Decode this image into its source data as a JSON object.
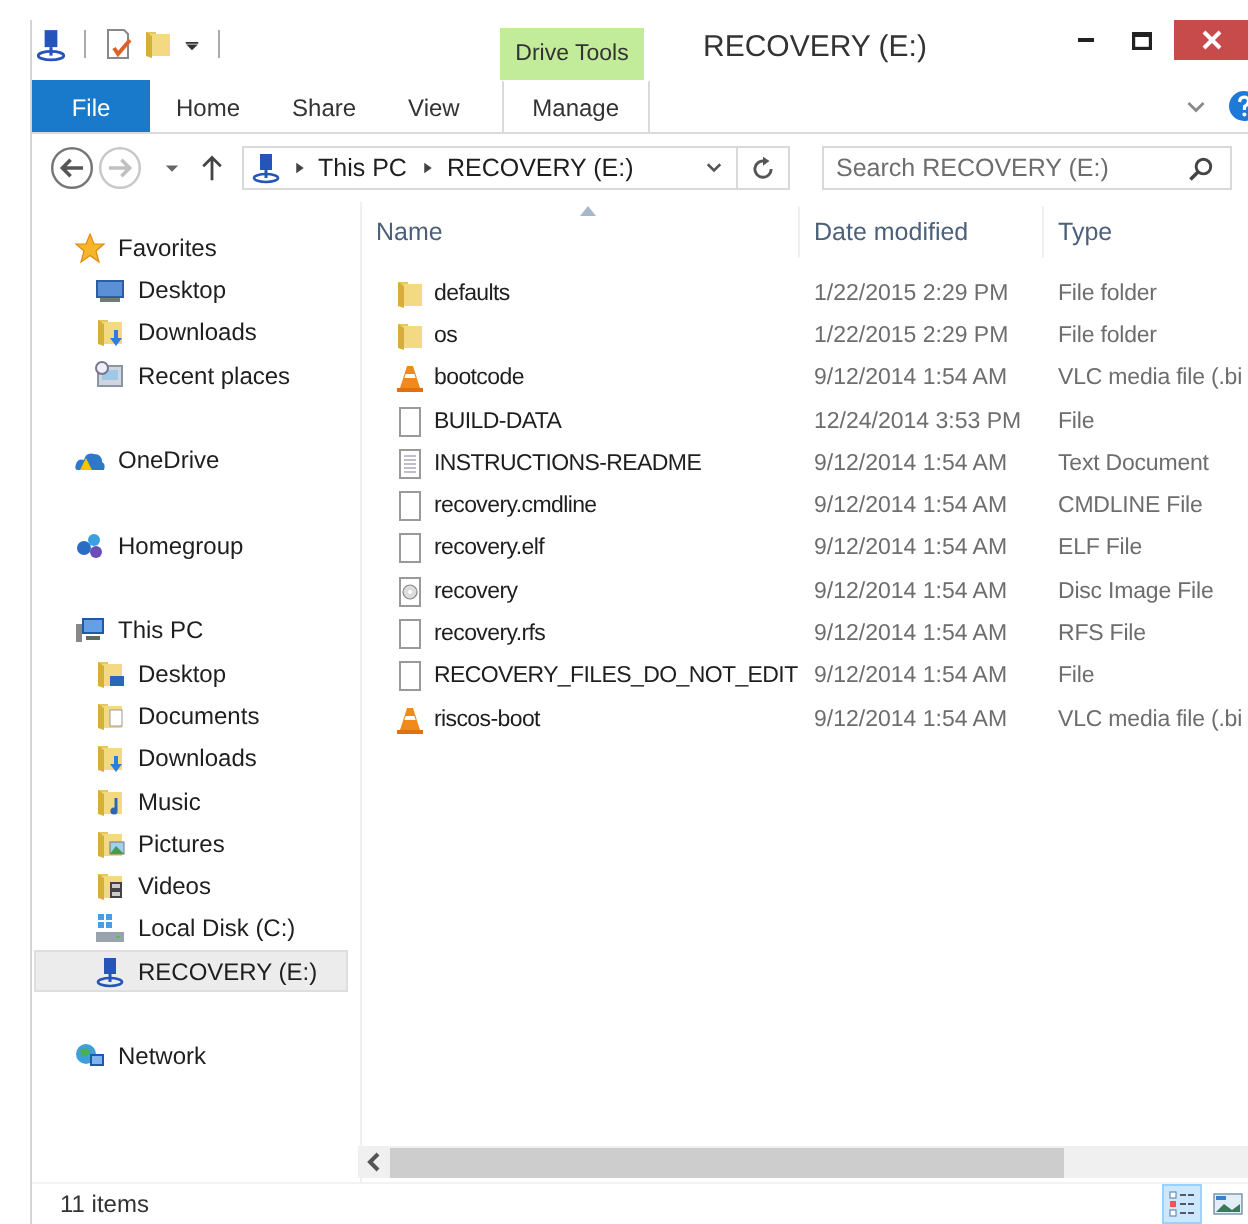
{
  "window": {
    "title": "RECOVERY (E:)",
    "context_tab": "Drive Tools"
  },
  "ribbon_tabs": [
    {
      "label": "File",
      "kind": "file",
      "selected": false
    },
    {
      "label": "Home",
      "kind": "tab",
      "selected": false
    },
    {
      "label": "Share",
      "kind": "tab",
      "selected": false
    },
    {
      "label": "View",
      "kind": "tab",
      "selected": false
    },
    {
      "label": "Manage",
      "kind": "context",
      "selected": false
    }
  ],
  "address": {
    "crumbs": [
      "This PC",
      "RECOVERY (E:)"
    ],
    "search": {
      "placeholder": "Search RECOVERY (E:)"
    }
  },
  "sidebar": {
    "groups": [
      {
        "label": "Favorites",
        "kind": "star",
        "selected": false,
        "children": [
          {
            "label": "Desktop",
            "kind": "desktop",
            "selected": false
          },
          {
            "label": "Downloads",
            "kind": "downloads",
            "selected": false
          },
          {
            "label": "Recent places",
            "kind": "recent",
            "selected": false
          }
        ]
      },
      {
        "label": "OneDrive",
        "kind": "cloud",
        "selected": false
      },
      {
        "label": "Homegroup",
        "kind": "homegroup",
        "selected": false
      },
      {
        "label": "This PC",
        "kind": "pc",
        "selected": false,
        "children": [
          {
            "label": "Desktop",
            "kind": "desktop-folder",
            "selected": false
          },
          {
            "label": "Documents",
            "kind": "documents",
            "selected": false
          },
          {
            "label": "Downloads",
            "kind": "downloads",
            "selected": false
          },
          {
            "label": "Music",
            "kind": "music",
            "selected": false
          },
          {
            "label": "Pictures",
            "kind": "pictures",
            "selected": false
          },
          {
            "label": "Videos",
            "kind": "videos",
            "selected": false
          },
          {
            "label": "Local Disk (C:)",
            "kind": "disk",
            "selected": false
          },
          {
            "label": "RECOVERY (E:)",
            "kind": "usb",
            "selected": true
          }
        ]
      },
      {
        "label": "Network",
        "kind": "network",
        "selected": false
      }
    ]
  },
  "table": {
    "columns": [
      {
        "label": "Name",
        "sorted": true
      },
      {
        "label": "Date modified",
        "sorted": false
      },
      {
        "label": "Type",
        "sorted": false
      }
    ],
    "rows": [
      {
        "name": "defaults",
        "date": "1/22/2015 2:29 PM",
        "type": "File folder",
        "kind": "folder"
      },
      {
        "name": "os",
        "date": "1/22/2015 2:29 PM",
        "type": "File folder",
        "kind": "folder"
      },
      {
        "name": "bootcode",
        "date": "9/12/2014 1:54 AM",
        "type": "VLC media file (.bi",
        "kind": "vlc"
      },
      {
        "name": "BUILD-DATA",
        "date": "12/24/2014 3:53 PM",
        "type": "File",
        "kind": "file"
      },
      {
        "name": "INSTRUCTIONS-README",
        "date": "9/12/2014 1:54 AM",
        "type": "Text Document",
        "kind": "text"
      },
      {
        "name": "recovery.cmdline",
        "date": "9/12/2014 1:54 AM",
        "type": "CMDLINE File",
        "kind": "file"
      },
      {
        "name": "recovery.elf",
        "date": "9/12/2014 1:54 AM",
        "type": "ELF File",
        "kind": "file"
      },
      {
        "name": "recovery",
        "date": "9/12/2014 1:54 AM",
        "type": "Disc Image File",
        "kind": "disc"
      },
      {
        "name": "recovery.rfs",
        "date": "9/12/2014 1:54 AM",
        "type": "RFS File",
        "kind": "file"
      },
      {
        "name": "RECOVERY_FILES_DO_NOT_EDIT",
        "date": "9/12/2014 1:54 AM",
        "type": "File",
        "kind": "file"
      },
      {
        "name": "riscos-boot",
        "date": "9/12/2014 1:54 AM",
        "type": "VLC media file (.bi",
        "kind": "vlc"
      }
    ]
  },
  "status_bar": {
    "count": "11 items",
    "views": [
      {
        "kind": "details",
        "selected": true
      },
      {
        "kind": "thumbnails",
        "selected": false
      }
    ]
  }
}
